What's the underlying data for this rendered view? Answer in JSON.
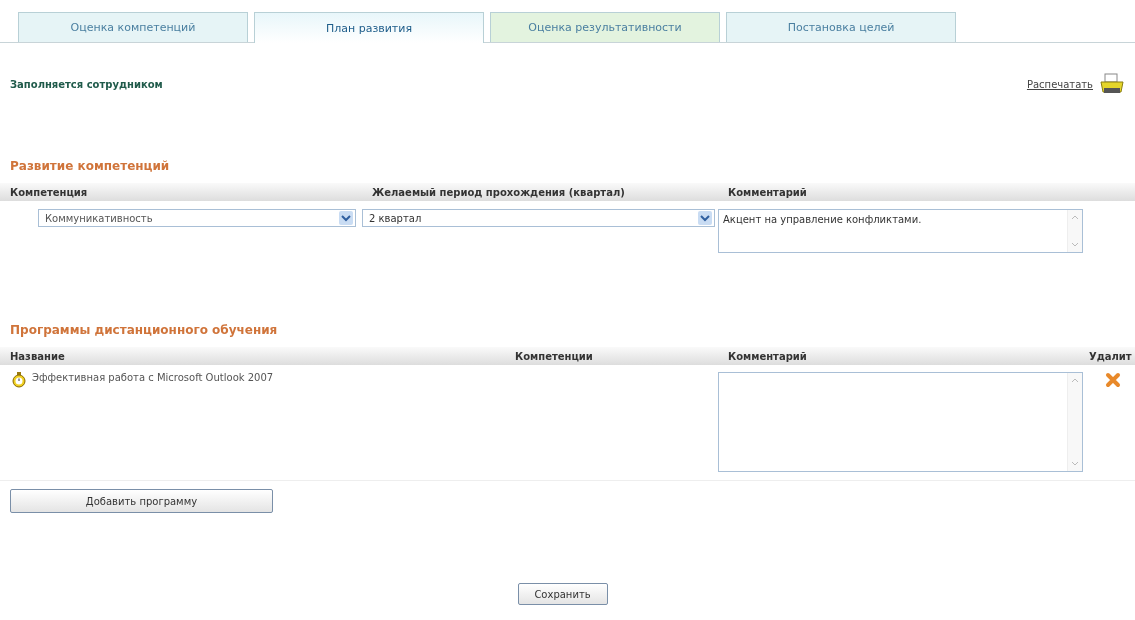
{
  "tabs": [
    {
      "label": "Оценка компетенций",
      "selected": false,
      "color": "#e6f4f6"
    },
    {
      "label": "План развития",
      "selected": true,
      "color": "#ffffff"
    },
    {
      "label": "Оценка результативности",
      "selected": false,
      "color": "#e3f3df"
    },
    {
      "label": "Постановка целей",
      "selected": false,
      "color": "#e6f4f6"
    }
  ],
  "note": "Заполняется сотрудником",
  "print_link": "Распечатать",
  "competency_section": {
    "title": "Развитие компетенций",
    "columns": [
      "Компетенция",
      "Желаемый период прохождения (квартал)",
      "Комментарий"
    ],
    "rows": [
      {
        "competency": "Коммуникативность",
        "period": "2 квартал",
        "comment": "Акцент на управление конфликтами."
      }
    ]
  },
  "programs_section": {
    "title": "Программы дистанционного обучения",
    "columns": [
      "Название",
      "Компетенции",
      "Комментарий",
      "Удалит"
    ],
    "rows": [
      {
        "name": "Эффективная работа с Microsoft Outlook 2007"
      }
    ],
    "add_button": "Добавить программу"
  },
  "save_button": "Сохранить"
}
